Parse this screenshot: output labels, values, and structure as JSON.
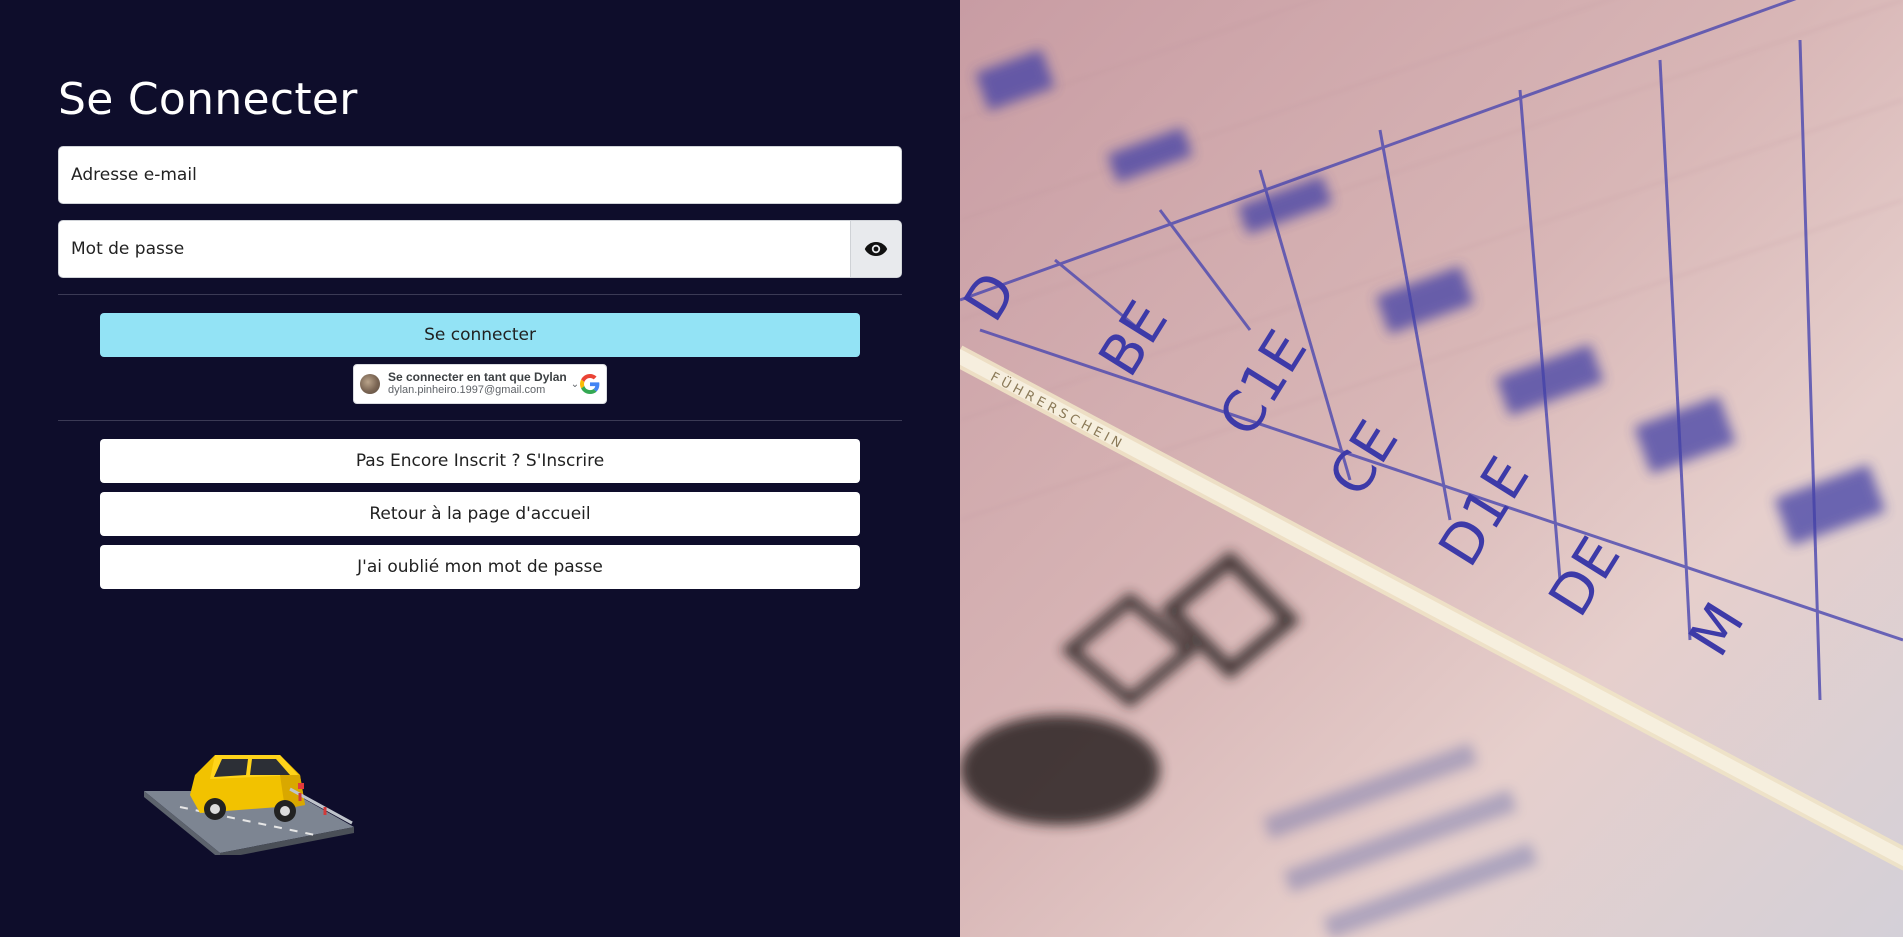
{
  "login": {
    "title": "Se Connecter",
    "email_placeholder": "Adresse e-mail",
    "password_placeholder": "Mot de passe",
    "submit_label": "Se connecter"
  },
  "google": {
    "line1": "Se connecter en tant que Dylan",
    "line2": "dylan.pinheiro.1997@gmail.com"
  },
  "links": {
    "signup": "Pas Encore Inscrit ? S'Inscrire",
    "home": "Retour à la page d'accueil",
    "forgot": "J'ai oublié mon mot de passe"
  },
  "license_categories": [
    "D",
    "BE",
    "C1E",
    "CE",
    "D1E",
    "DE",
    "M"
  ],
  "license_strip_text": "FÜHRERSCHEIN",
  "icons": {
    "eye": "eye-icon",
    "google": "google-logo-icon",
    "chevron": "chevron-down-icon",
    "car": "car-illustration"
  },
  "colors": {
    "background": "#0e0d2b",
    "primary_button": "#93e3f5",
    "license_ink": "#3d3aa8"
  }
}
